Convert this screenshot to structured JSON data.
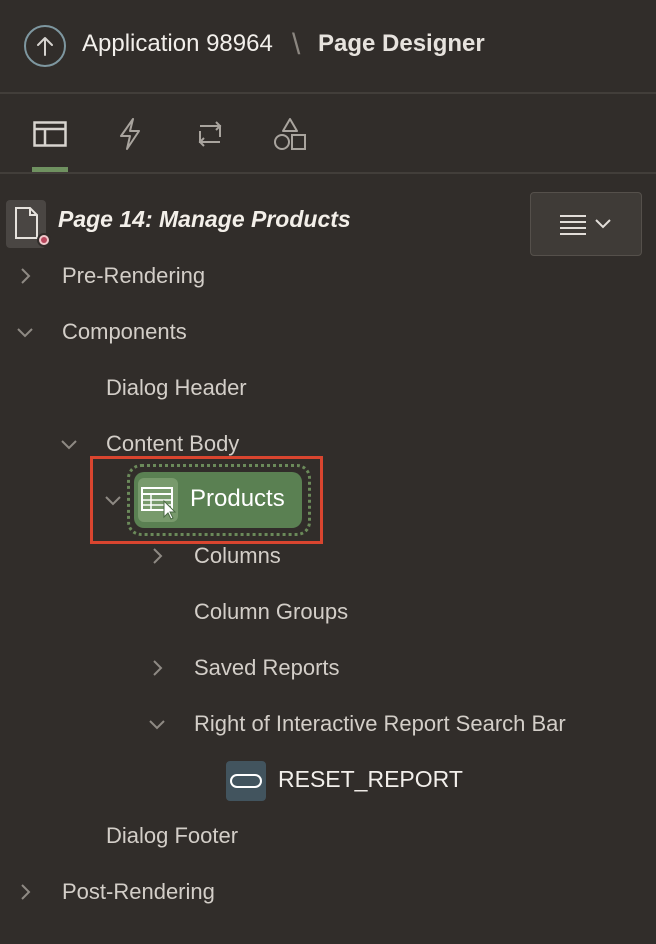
{
  "header": {
    "app_title": "Application 98964",
    "separator": "\\",
    "page_title": "Page Designer"
  },
  "tabs": [
    {
      "name": "rendering",
      "icon": "layout-icon",
      "active": true
    },
    {
      "name": "dynamic-actions",
      "icon": "lightning-icon",
      "active": false
    },
    {
      "name": "processing",
      "icon": "refresh-icon",
      "active": false
    },
    {
      "name": "shared-components",
      "icon": "shapes-icon",
      "active": false
    }
  ],
  "tree": {
    "page_label": "Page 14: Manage Products",
    "pre_rendering": "Pre-Rendering",
    "components": "Components",
    "dialog_header": "Dialog Header",
    "content_body": "Content Body",
    "products": "Products",
    "columns": "Columns",
    "column_groups": "Column Groups",
    "saved_reports": "Saved Reports",
    "right_of_search_bar": "Right of Interactive Report Search Bar",
    "reset_report": "RESET_REPORT",
    "dialog_footer": "Dialog Footer",
    "post_rendering": "Post-Rendering"
  },
  "colors": {
    "background": "#312d2a",
    "selection_green": "#5a8052",
    "highlight_red": "#d9452f",
    "active_tab": "#6f9160"
  }
}
